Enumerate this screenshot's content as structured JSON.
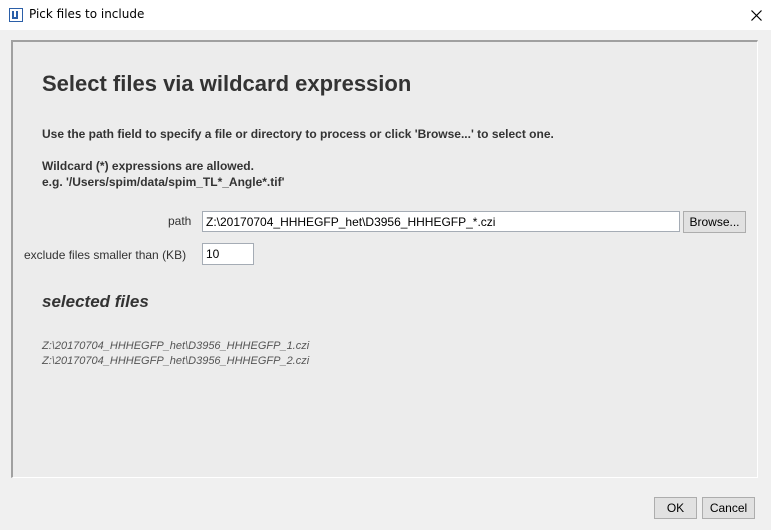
{
  "window": {
    "title": "Pick files to include",
    "icon": "imagej-icon",
    "close_icon": "close-icon"
  },
  "main": {
    "heading": "Select files via wildcard expression",
    "instruction": "Use the path field to specify a file or directory to process or click 'Browse...' to select one.",
    "wildcard_note": "Wildcard (*) expressions are allowed.",
    "wildcard_example": "e.g. '/Users/spim/data/spim_TL*_Angle*.tif'",
    "path_label": "path",
    "path_value": "Z:\\20170704_HHHEGFP_het\\D3956_HHHEGFP_*.czi",
    "browse_label": "Browse...",
    "exclude_label": "exclude files smaller than (KB)",
    "exclude_value": "10",
    "selected_heading": "selected files",
    "selected_files": [
      "Z:\\20170704_HHHEGFP_het\\D3956_HHHEGFP_1.czi",
      "Z:\\20170704_HHHEGFP_het\\D3956_HHHEGFP_2.czi"
    ]
  },
  "footer": {
    "ok_label": "OK",
    "cancel_label": "Cancel"
  }
}
